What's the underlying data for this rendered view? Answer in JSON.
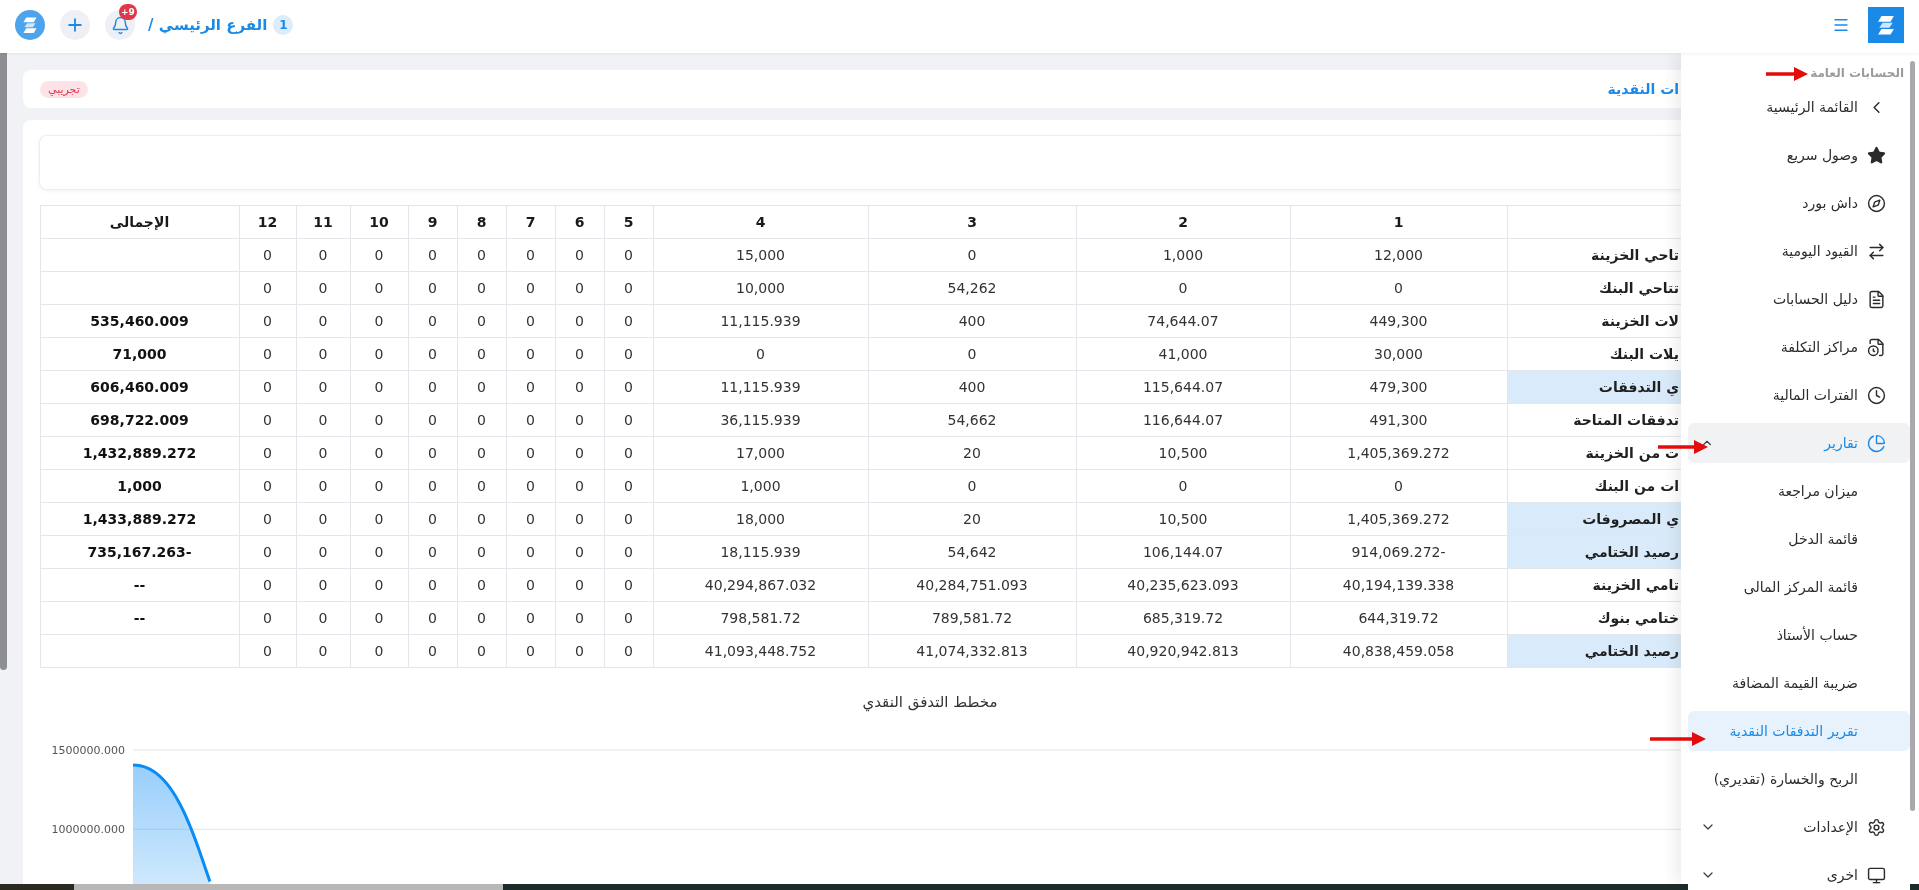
{
  "top_bar": {
    "branch_number": "1",
    "branch_name": "الفرع الرئيسي /",
    "notification_count": "+9"
  },
  "page_header": {
    "title": "ات النقدية",
    "tag": "تجريبي"
  },
  "table": {
    "columns": [
      "1",
      "2",
      "3",
      "4",
      "5",
      "6",
      "7",
      "8",
      "9",
      "10",
      "11",
      "12",
      "الإجمالى"
    ],
    "rows": [
      {
        "label": "تاحي الخزينة",
        "highlighted": false,
        "values": [
          "12,000",
          "1,000",
          "0",
          "15,000",
          "0",
          "0",
          "0",
          "0",
          "0",
          "0",
          "0",
          "0"
        ]
      },
      {
        "label": "تتاحي البنك",
        "highlighted": false,
        "values": [
          "0",
          "0",
          "54,262",
          "10,000",
          "0",
          "0",
          "0",
          "0",
          "0",
          "0",
          "0",
          "0"
        ]
      },
      {
        "label": "لات الخزينة",
        "highlighted": false,
        "values": [
          "449,300",
          "74,644.07",
          "400",
          "11,115.939",
          "0",
          "0",
          "0",
          "0",
          "0",
          "0",
          "0",
          "0"
        ],
        "total": "535,460.009"
      },
      {
        "label": "يلات البنك",
        "highlighted": false,
        "values": [
          "30,000",
          "41,000",
          "0",
          "0",
          "0",
          "0",
          "0",
          "0",
          "0",
          "0",
          "0",
          "0"
        ],
        "total": "71,000"
      },
      {
        "label": "ي التدفقات",
        "highlighted": true,
        "values": [
          "479,300",
          "115,644.07",
          "400",
          "11,115.939",
          "0",
          "0",
          "0",
          "0",
          "0",
          "0",
          "0",
          "0"
        ],
        "total": "606,460.009"
      },
      {
        "label": "تدفقات المتاحة",
        "highlighted": false,
        "values": [
          "491,300",
          "116,644.07",
          "54,662",
          "36,115.939",
          "0",
          "0",
          "0",
          "0",
          "0",
          "0",
          "0",
          "0"
        ],
        "total": "698,722.009"
      },
      {
        "label": "ت من الخزينة",
        "highlighted": false,
        "values": [
          "1,405,369.272",
          "10,500",
          "20",
          "17,000",
          "0",
          "0",
          "0",
          "0",
          "0",
          "0",
          "0",
          "0"
        ],
        "total": "1,432,889.272"
      },
      {
        "label": "ات من البنك",
        "highlighted": false,
        "values": [
          "0",
          "0",
          "0",
          "1,000",
          "0",
          "0",
          "0",
          "0",
          "0",
          "0",
          "0",
          "0"
        ],
        "total": "1,000"
      },
      {
        "label": "ي المصروفات",
        "highlighted": true,
        "values": [
          "1,405,369.272",
          "10,500",
          "20",
          "18,000",
          "0",
          "0",
          "0",
          "0",
          "0",
          "0",
          "0",
          "0"
        ],
        "total": "1,433,889.272"
      },
      {
        "label": "رصيد الختامي",
        "highlighted": true,
        "values": [
          "914,069.272-",
          "106,144.07",
          "54,642",
          "18,115.939",
          "0",
          "0",
          "0",
          "0",
          "0",
          "0",
          "0",
          "0"
        ],
        "total": "735,167.263-"
      },
      {
        "label": "تامي الخزينة",
        "highlighted": false,
        "values": [
          "40,194,139.338",
          "40,235,623.093",
          "40,284,751.093",
          "40,294,867.032",
          "0",
          "0",
          "0",
          "0",
          "0",
          "0",
          "0",
          "0"
        ],
        "total": "--"
      },
      {
        "label": "ختامي بنوك",
        "highlighted": false,
        "values": [
          "644,319.72",
          "685,319.72",
          "789,581.72",
          "798,581.72",
          "0",
          "0",
          "0",
          "0",
          "0",
          "0",
          "0",
          "0"
        ],
        "total": "--"
      },
      {
        "label": "رصيد الختامي",
        "highlighted": true,
        "values": [
          "40,838,459.058",
          "40,920,942.813",
          "41,074,332.813",
          "41,093,448.752",
          "0",
          "0",
          "0",
          "0",
          "0",
          "0",
          "0",
          "0"
        ]
      }
    ]
  },
  "chart": {
    "title": "مخطط التدفق النقدي",
    "y_axis_labels": [
      "1500000.000",
      "1000000.000"
    ]
  },
  "sidebar": {
    "section_title": "الحسابات العامة",
    "items": [
      {
        "label": "القائمة الرئيسية",
        "kind": "back",
        "selected": false
      },
      {
        "label": "وصول سريع",
        "kind": "link",
        "selected": false
      },
      {
        "label": "داش بورد",
        "kind": "link",
        "selected": false
      },
      {
        "label": "القيود اليومية",
        "kind": "link",
        "selected": false
      },
      {
        "label": "دليل الحسابات",
        "kind": "link",
        "selected": false
      },
      {
        "label": "مراكز التكلفة",
        "kind": "link",
        "selected": false
      },
      {
        "label": "الفترات المالية",
        "kind": "link",
        "selected": false
      },
      {
        "label": "تقارير",
        "kind": "group",
        "selected": true,
        "expanded": true,
        "children": [
          {
            "label": "ميزان مراجعة",
            "selected": false
          },
          {
            "label": "قائمة الدخل",
            "selected": false
          },
          {
            "label": "قائمة المركز المالى",
            "selected": false
          },
          {
            "label": "حساب الأستاذ",
            "selected": false
          },
          {
            "label": "ضريبة القيمة المضافة",
            "selected": false
          },
          {
            "label": "تقرير التدفقات النقدية",
            "selected": true
          },
          {
            "label": "الربح والخسارة (تقديري)",
            "selected": false
          }
        ]
      },
      {
        "label": "الإعدادات",
        "kind": "group",
        "selected": false,
        "expanded": false
      },
      {
        "label": "اخرى",
        "kind": "group",
        "selected": false,
        "expanded": false
      }
    ]
  }
}
